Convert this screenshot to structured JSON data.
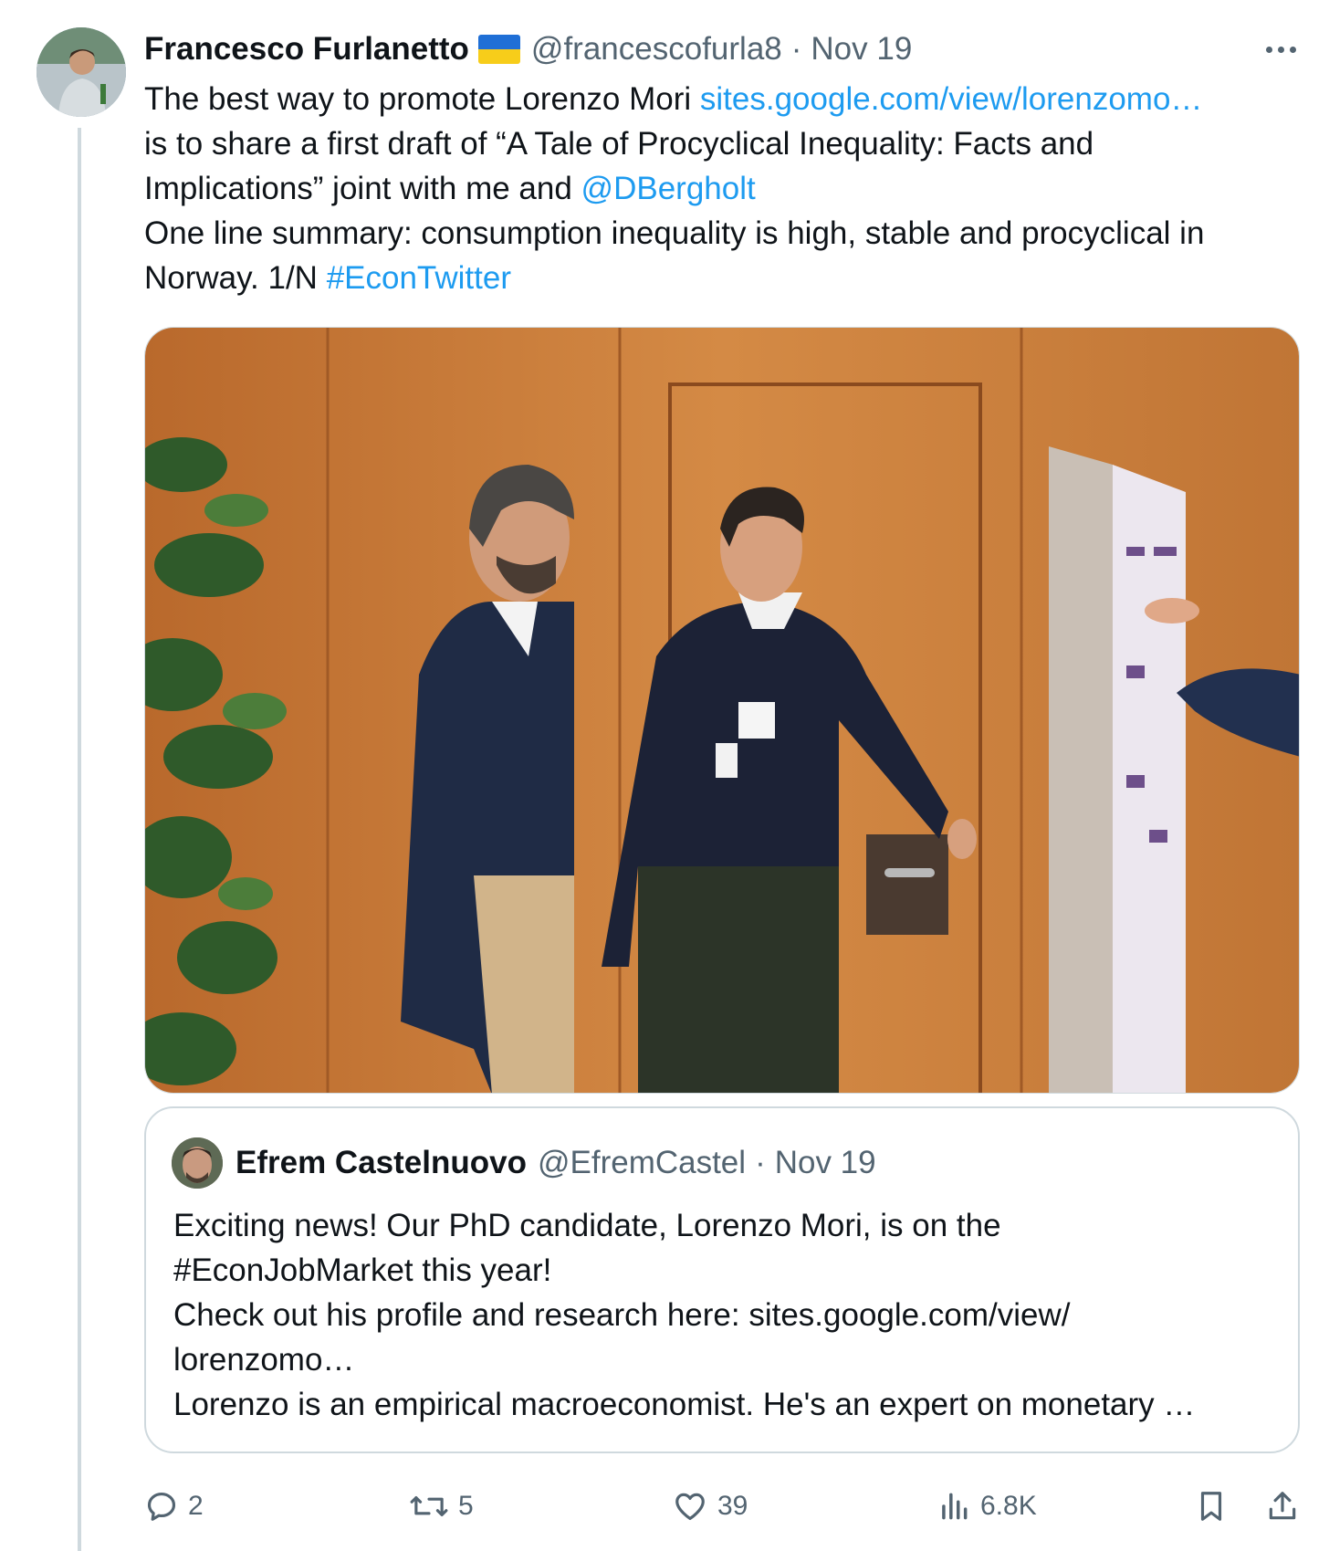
{
  "tweet": {
    "author_name": "Francesco Furlanetto",
    "flag_icon": "ukraine-flag-icon",
    "handle": "@francescofurla8",
    "separator": "·",
    "date": "Nov 19",
    "more_icon": "more-icon",
    "text_line1_prefix": "The best way to promote Lorenzo Mori ",
    "text_line1_link": "sites.google.com/view/lorenzomo…",
    "text_line2": "is to share a first draft of “A Tale of Procyclical Inequality: Facts and",
    "text_line3_prefix": "Implications” joint with me and ",
    "text_line3_mention": "@DBergholt",
    "text_line4": "One line summary: consumption inequality is high, stable and procyclical in",
    "text_line5_prefix": "Norway. 1/N ",
    "text_line5_hashtag": "#EconTwitter"
  },
  "quote": {
    "author_name": "Efrem Castelnuovo",
    "handle": "@EfremCastel",
    "separator": "·",
    "date": "Nov 19",
    "line1": "Exciting news! Our PhD candidate, Lorenzo Mori, is on the",
    "line2": "#EconJobMarket this year!",
    "line3": "Check out his profile and research here: sites.google.com/view/",
    "line4": "lorenzomo…",
    "line5": "Lorenzo is an empirical macroeconomist. He's an expert on monetary …"
  },
  "actions": {
    "reply_count": "2",
    "retweet_count": "5",
    "like_count": "39",
    "views_count": "6.8K",
    "icons": [
      "reply-icon",
      "retweet-icon",
      "like-icon",
      "views-icon",
      "bookmark-icon",
      "share-icon"
    ]
  },
  "colors": {
    "link": "#1d9bf0",
    "muted": "#536471",
    "border": "#cfd9de",
    "text": "#0f1419"
  }
}
